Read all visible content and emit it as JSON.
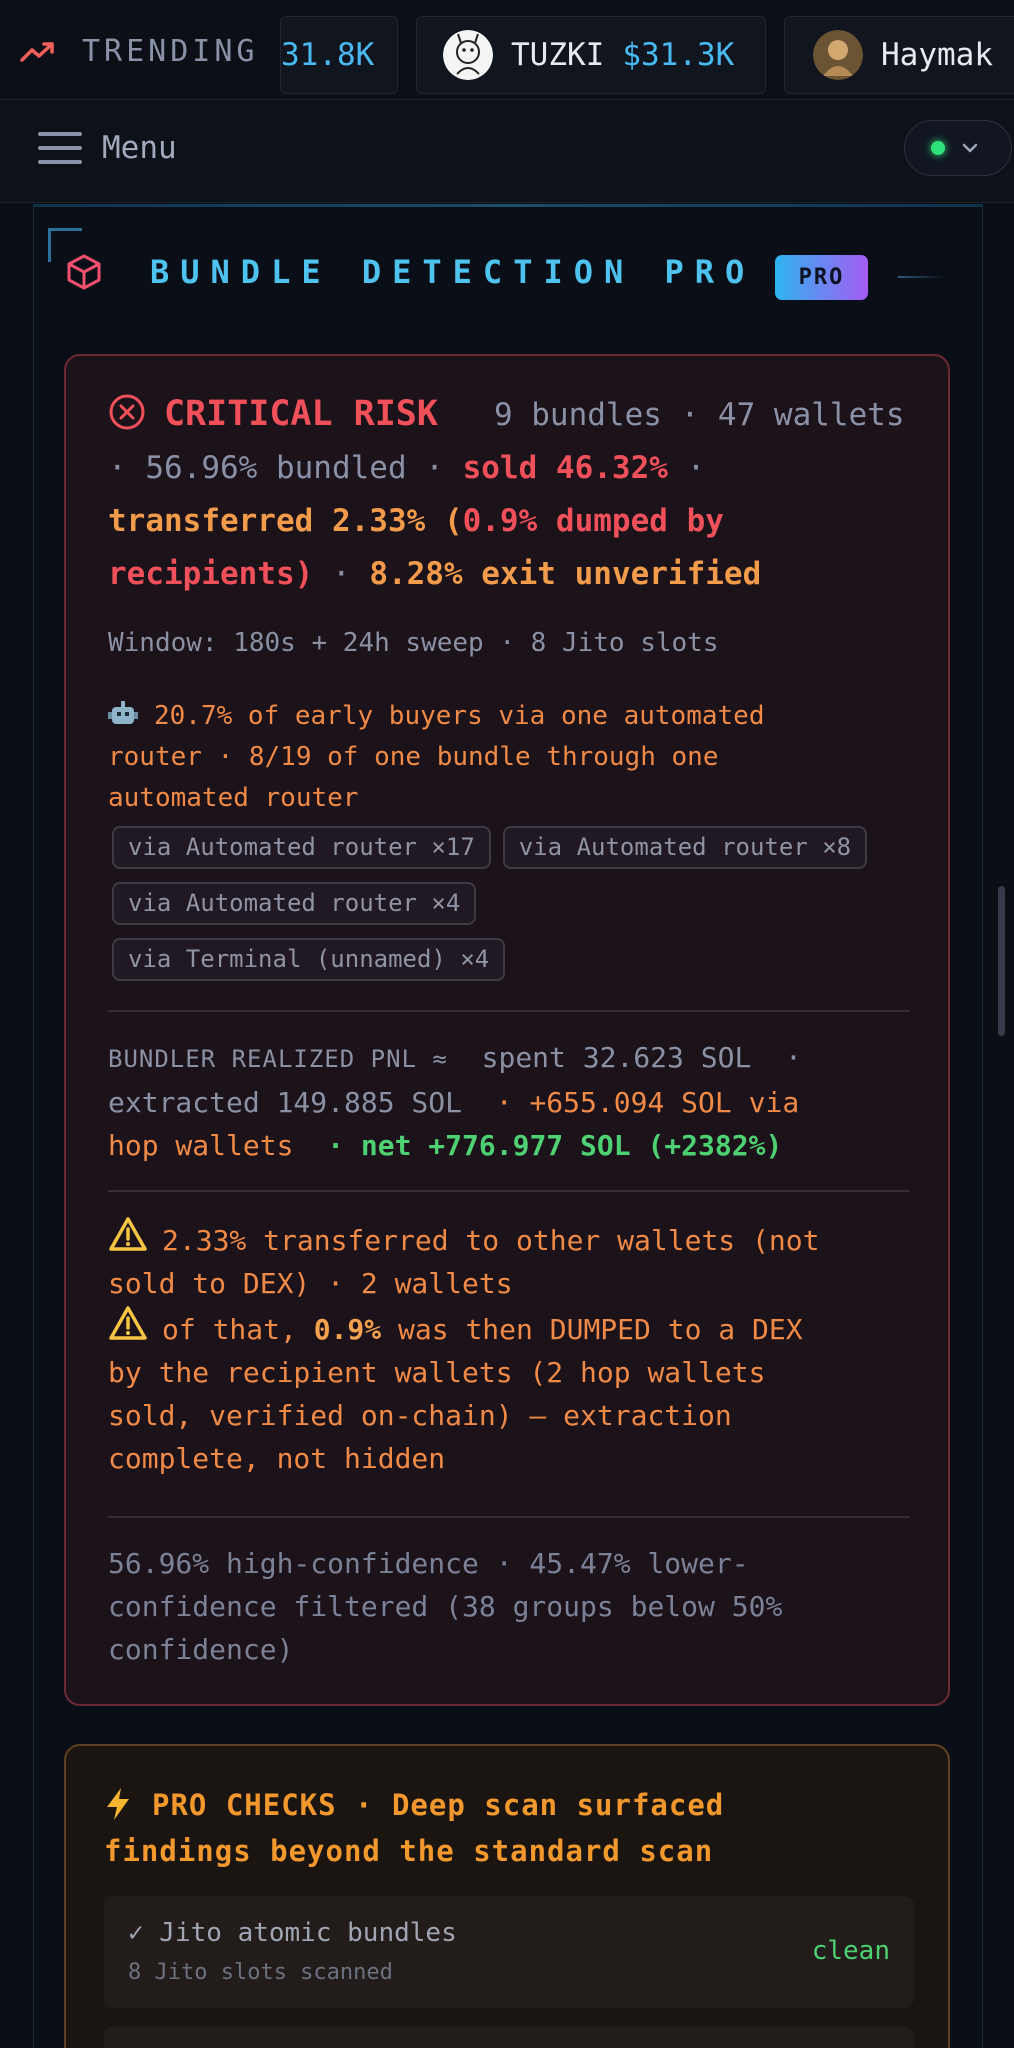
{
  "ticker": {
    "trending_label": "TRENDING",
    "items": [
      {
        "symbol": "",
        "price": "31.8K"
      },
      {
        "symbol": "TUZKI",
        "price": "$31.3K"
      },
      {
        "symbol": "Haymak",
        "price": ""
      }
    ]
  },
  "menubar": {
    "menu_label": "Menu",
    "status": "online"
  },
  "panel": {
    "title": "BUNDLE DETECTION PRO",
    "badge": "PRO"
  },
  "critical": {
    "level": "CRITICAL RISK",
    "bundles": "9 bundles",
    "wallets_num": "47",
    "wallets_word": "wallets",
    "bundled": "56.96% bundled",
    "sold": "sold 46.32%",
    "transferred_line1": "transferred 2.33% (",
    "dumped": "0.9% dumped by",
    "recipients": "recipients)",
    "exit": "8.28% exit unverified",
    "window": "Window: 180s + 24h sweep · 8 Jito slots",
    "router_line1": "20.7% of early buyers via one automated",
    "router_line2": "router · 8/19 of one bundle through one",
    "router_line3": "automated router",
    "chips": [
      "via Automated router ×17",
      "via Automated router ×8",
      "via Automated router ×4",
      "via Terminal (unnamed) ×4"
    ],
    "pnl_label": "BUNDLER REALIZED PNL ≈",
    "pnl_spent": "spent 32.623 SOL",
    "pnl_extracted": "extracted 149.885 SOL",
    "pnl_hop_1": "+655.094 SOL via",
    "pnl_hop_2": "hop wallets",
    "pnl_net": "net +776.977 SOL (+2382%)",
    "warn1_line1": "2.33% transferred to other wallets (not",
    "warn1_line2": "sold to DEX) · 2 wallets",
    "warn2_pre": "of that,",
    "warn2_bold": "0.9%",
    "warn2_post": "was then DUMPED to a DEX",
    "warn2_line2": "by the recipient wallets (2 hop wallets",
    "warn2_line3": "sold, verified on-chain) — extraction",
    "warn2_line4": "complete, not hidden",
    "conf_line1": "56.96% high-confidence · 45.47% lower-",
    "conf_line2": "confidence filtered (38 groups below 50%",
    "conf_line3": "confidence)"
  },
  "pro_checks": {
    "heading_line1": "PRO CHECKS · Deep scan surfaced",
    "heading_line2": "findings beyond the standard scan",
    "rows": [
      {
        "title": "✓ Jito atomic bundles",
        "subtitle": "8 Jito slots scanned",
        "status": "clean"
      }
    ]
  },
  "colors": {
    "accent_cyan": "#4ec3f0",
    "critical_red": "#f0505a",
    "warning_orange": "#f08a46",
    "positive_green": "#4ed172"
  }
}
